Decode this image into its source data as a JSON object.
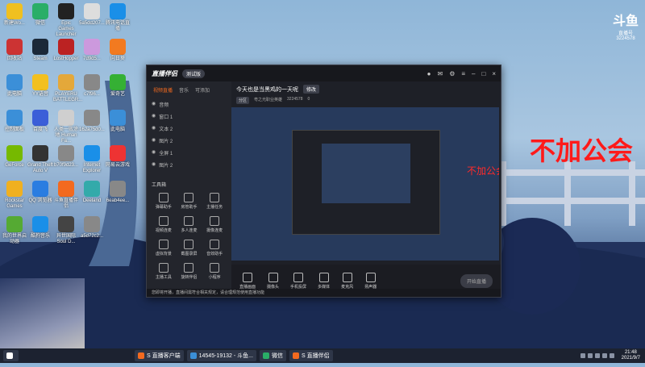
{
  "desktop_icons": [
    {
      "label": "新建Wo...",
      "color": "#f0c020"
    },
    {
      "label": "微信",
      "color": "#2aae67"
    },
    {
      "label": "Epic Games Launcher",
      "color": "#222"
    },
    {
      "label": "5a5dd207...",
      "color": "#ddd"
    },
    {
      "label": "腾讯电话直播",
      "color": "#1a8fe8"
    },
    {
      "label": "回收站",
      "color": "#c33"
    },
    {
      "label": "Steam",
      "color": "#1b2838"
    },
    {
      "label": "LostHopper",
      "color": "#b22"
    },
    {
      "label": "7d9d5...",
      "color": "#c9d"
    },
    {
      "label": "向日葵",
      "color": "#f27a20"
    },
    {
      "label": "此电脑",
      "color": "#3b8fd8"
    },
    {
      "label": "YY语音",
      "color": "#f2c020"
    },
    {
      "label": "PLAYERU BATTLEGR...",
      "color": "#e4a83a"
    },
    {
      "label": "c7f96...",
      "color": "#888"
    },
    {
      "label": "爱奇艺",
      "color": "#35b034"
    },
    {
      "label": "控制面板",
      "color": "#3b8fd8"
    },
    {
      "label": "百度飞",
      "color": "#3b5ed8"
    },
    {
      "label": "人类一败涂地 Human Fa...",
      "color": "#cfcfcf"
    },
    {
      "label": "162a75d0...",
      "color": "#888"
    },
    {
      "label": "此电脑",
      "color": "#3b8fd8"
    },
    {
      "label": "GeForce",
      "color": "#76b900"
    },
    {
      "label": "Grand Theft Auto V",
      "color": "#333"
    },
    {
      "label": "b70f9d23...",
      "color": "#888"
    },
    {
      "label": "Internet Explorer",
      "color": "#1a8fe8"
    },
    {
      "label": "网易云游戏",
      "color": "#e33"
    },
    {
      "label": "Rockstar Games",
      "color": "#f0b020"
    },
    {
      "label": "QQ 浏览器",
      "color": "#2a7de1"
    },
    {
      "label": "斗鱼直播伴侣",
      "color": "#f36a1f"
    },
    {
      "label": "Deeland",
      "color": "#3aa"
    },
    {
      "label": "6eab4ee...",
      "color": "#888"
    },
    {
      "label": "我的世界启动器",
      "color": "#5a3"
    },
    {
      "label": "酷狗音乐",
      "color": "#1a8fe8"
    },
    {
      "label": "异世国际 Soul D...",
      "color": "#444"
    },
    {
      "label": "a5d72c2...",
      "color": "#888"
    }
  ],
  "app": {
    "title": "直播伴侣",
    "beta": "测试版",
    "tabs": [
      "视频直播",
      "音乐",
      "可添加"
    ],
    "scenes": [
      "音频",
      "窗口 1",
      "文本 2",
      "图片 2",
      "全屏 1",
      "图片 2"
    ],
    "tools_title": "工具箱",
    "tools": [
      "弹幕助手",
      "房管助手",
      "主播任务",
      "视频连麦",
      "多人连麦",
      "摄像连麦",
      "虚拟背景",
      "截图录屏",
      "音效助手",
      "主播工具",
      "旋转伴侣",
      "小程序"
    ],
    "stream_title": "今天也是当黑鸡的一天呢",
    "edit_label": "修改",
    "meta": [
      "分区",
      "粤之光职业英雄",
      "3224578",
      "0"
    ],
    "controls": [
      "直播画面",
      "摄像头",
      "手机投屏",
      "多媒体",
      "麦克风",
      "扬声器"
    ],
    "start_label": "开始直播",
    "notice": "您即将开播，直播间需符合相关规定，请合理规范使用直播功能"
  },
  "overlay_text": "不加公会",
  "inner_overlay_text": "不加公会",
  "douyu": {
    "brand": "斗鱼",
    "sub": "直播号",
    "room": "3224578"
  },
  "taskbar": {
    "items": [
      "S 直播客户端",
      "14545-19132 - 斗鱼...",
      "微信",
      "S 直播伴侣"
    ],
    "time": "21:48",
    "date": "2021/9/7"
  }
}
